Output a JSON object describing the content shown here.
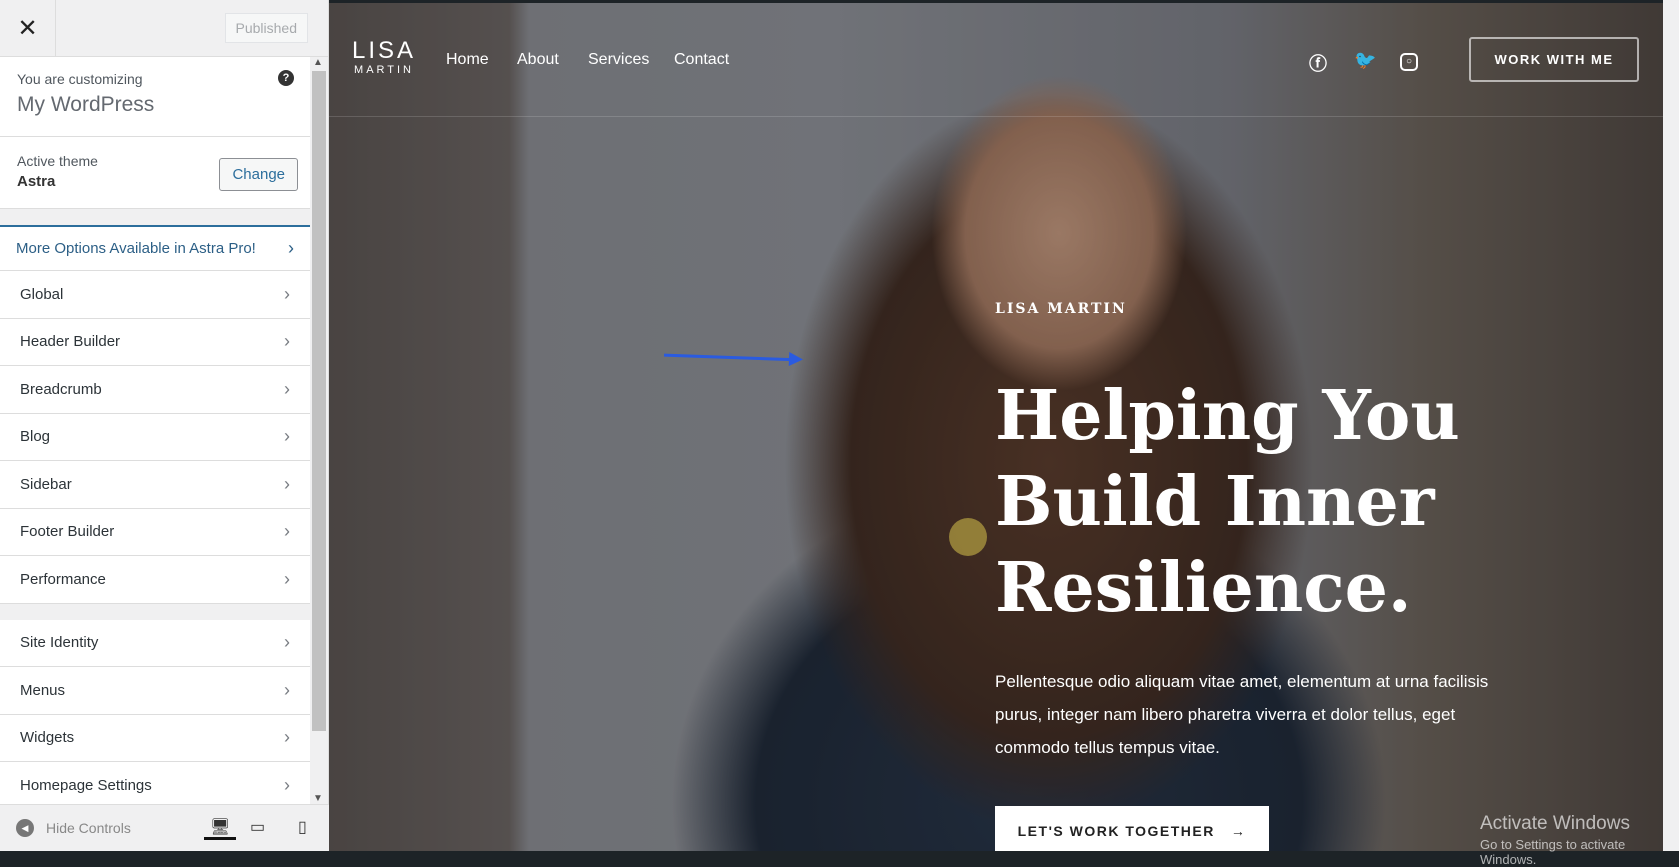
{
  "sidebar": {
    "close_label": "✕",
    "published_label": "Published",
    "customizing_label": "You are customizing",
    "site_name": "My WordPress",
    "help_icon": "?",
    "active_theme_label": "Active theme",
    "theme_name": "Astra",
    "change_label": "Change",
    "pro_label": "More Options Available in Astra Pro!",
    "items_group1": [
      {
        "label": "Global"
      },
      {
        "label": "Header Builder"
      },
      {
        "label": "Breadcrumb"
      },
      {
        "label": "Blog"
      },
      {
        "label": "Sidebar"
      },
      {
        "label": "Footer Builder"
      },
      {
        "label": "Performance"
      }
    ],
    "items_group2": [
      {
        "label": "Site Identity"
      },
      {
        "label": "Menus"
      },
      {
        "label": "Widgets"
      },
      {
        "label": "Homepage Settings"
      }
    ],
    "hide_controls_label": "Hide Controls",
    "devices": [
      "desktop-icon",
      "tablet-icon",
      "mobile-icon"
    ]
  },
  "preview": {
    "logo_top": "LISA",
    "logo_bottom": "MARTIN",
    "nav": [
      "Home",
      "About",
      "Services",
      "Contact"
    ],
    "social": [
      "facebook-icon",
      "twitter-icon",
      "instagram-icon"
    ],
    "work_with_me": "WORK WITH ME",
    "eyebrow": "LISA MARTIN",
    "heading": "Helping You Build Inner Resilience.",
    "paragraph": "Pellentesque odio aliquam vitae amet, elementum at urna facilisis purus, integer nam libero pharetra viverra et dolor tellus, eget commodo tellus tempus vitae.",
    "cta": "LET'S WORK TOGETHER",
    "cta_arrow": "→"
  },
  "watermark": {
    "line1": "Activate Windows",
    "line2": "Go to Settings to activate Windows."
  },
  "colors": {
    "accent": "#2c6e9c",
    "annotation_arrow": "#2a5be0"
  }
}
